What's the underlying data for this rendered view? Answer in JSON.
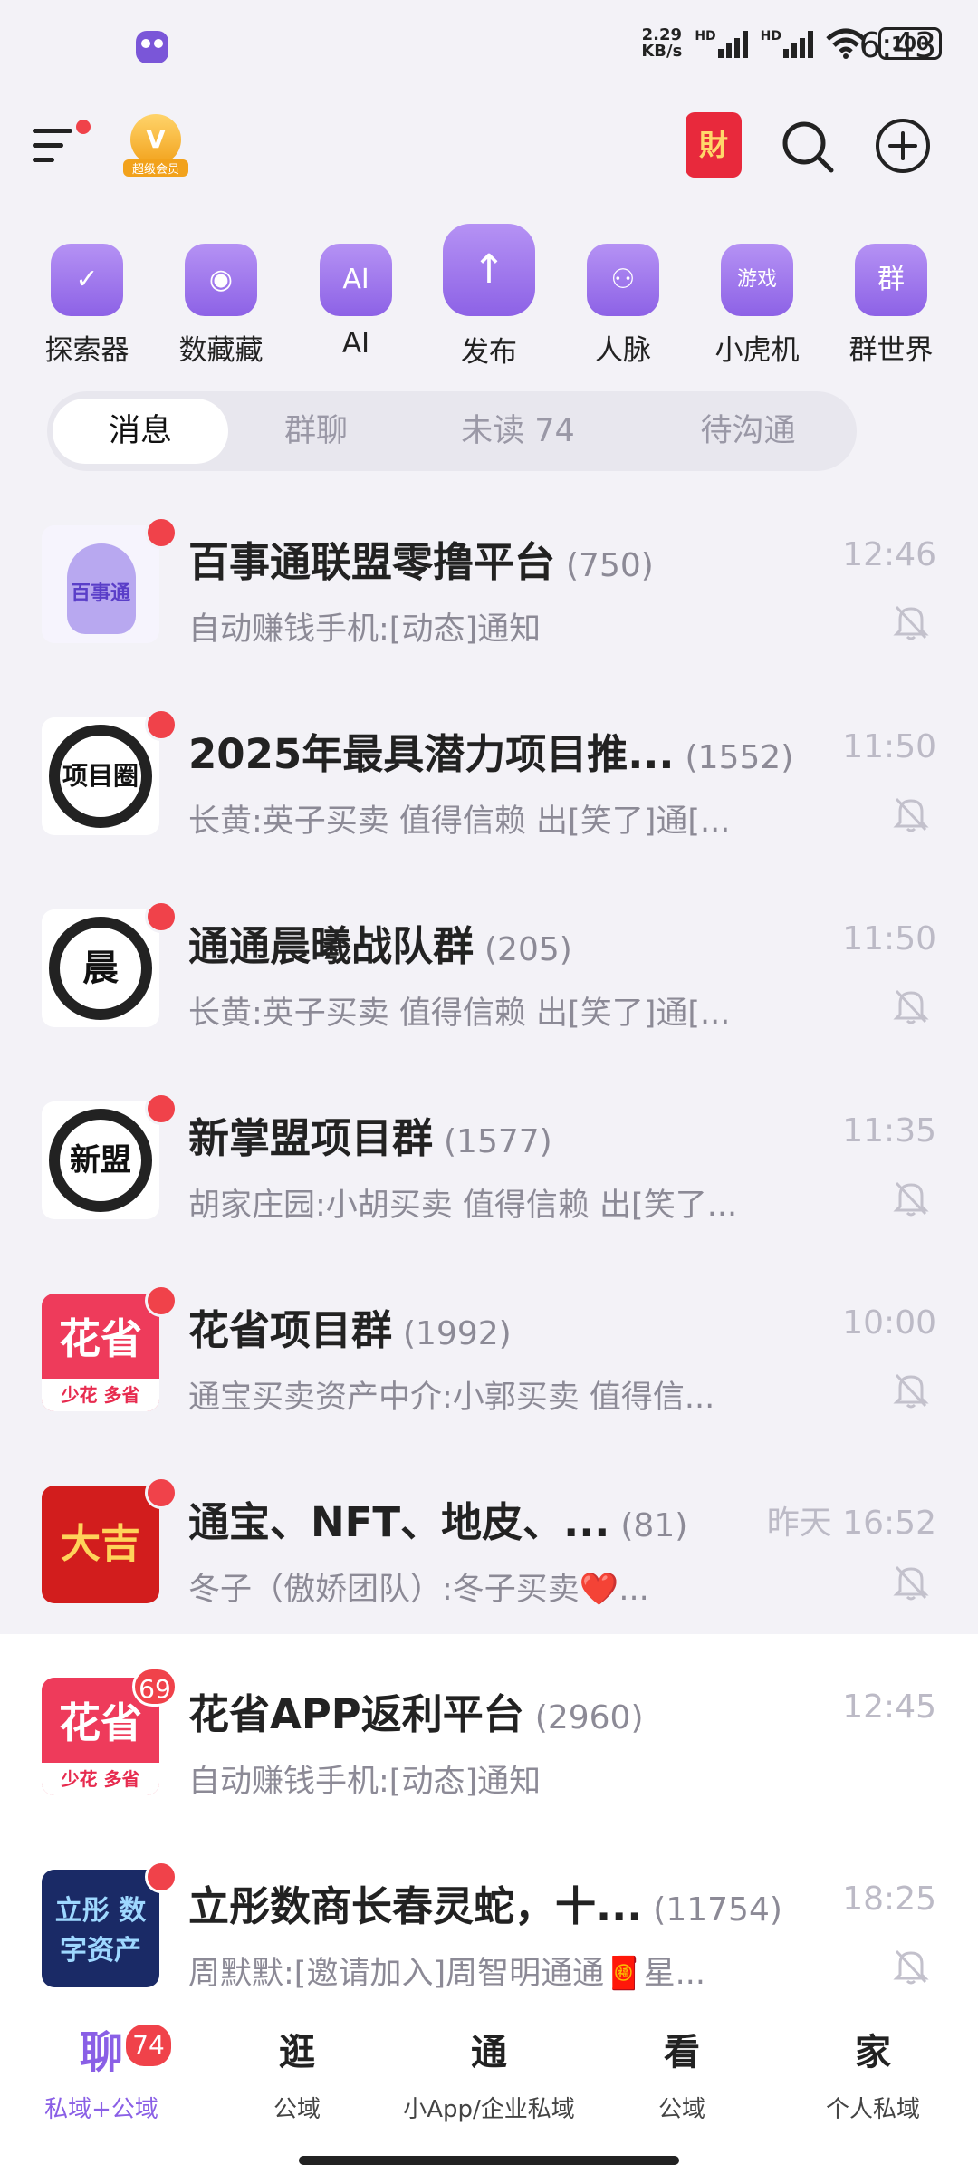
{
  "status_bar": {
    "time": "6:43",
    "netspeed_value": "2.29",
    "netspeed_unit": "KB/s",
    "hd1": "HD",
    "hd2": "HD",
    "battery": "100"
  },
  "header": {
    "vip_letter": "V",
    "vip_label": "超级会员",
    "redpacket_char": "財"
  },
  "shortcuts": [
    {
      "label": "探索器",
      "icon": "✓"
    },
    {
      "label": "数藏藏",
      "icon": "◉"
    },
    {
      "label": "AI",
      "icon": "AI"
    },
    {
      "label": "发布",
      "icon": "↑"
    },
    {
      "label": "人脉",
      "icon": "⚇"
    },
    {
      "label": "小虎机",
      "icon": "游戏"
    },
    {
      "label": "群世界",
      "icon": "群"
    }
  ],
  "tabs": [
    "消息",
    "群聊",
    "未读 74",
    "待沟通"
  ],
  "chats": [
    {
      "title": "百事通联盟零撸平台",
      "count": "(750)",
      "time": "12:46",
      "preview": "自动赚钱手机:[动态]通知",
      "avatar_text": "百事通"
    },
    {
      "title": "2025年最具潜力项目推...",
      "count": "(1552)",
      "time": "11:50",
      "preview": "长黄:英子买卖 值得信赖 出[笑了]通[...",
      "avatar_text": "项目圈"
    },
    {
      "title": "通通晨曦战队群",
      "count": "(205)",
      "time": "11:50",
      "preview": "长黄:英子买卖 值得信赖 出[笑了]通[...",
      "avatar_text": "晨"
    },
    {
      "title": "新掌盟项目群",
      "count": "(1577)",
      "time": "11:35",
      "preview": "胡家庄园:小胡买卖 值得信赖 出[笑了...",
      "avatar_text": "新盟"
    },
    {
      "title": "花省项目群",
      "count": "(1992)",
      "time": "10:00",
      "preview": "通宝买卖资产中介:小郭买卖 值得信...",
      "avatar_text": "花省",
      "avatar_sub": "少花 多省"
    },
    {
      "title": "通宝、NFT、地皮、...",
      "count": "(81)",
      "time": "昨天 16:52",
      "preview": "冬子（傲娇团队）:冬子买卖❤️...",
      "avatar_text": "大吉"
    },
    {
      "title": "花省APP返利平台",
      "count": "(2960)",
      "time": "12:45",
      "preview": "自动赚钱手机:[动态]通知",
      "avatar_text": "花省",
      "avatar_sub": "少花 多省",
      "badge": "69"
    },
    {
      "title": "立彤数商长春灵蛇，十...",
      "count": "(11754)",
      "time": "18:25",
      "preview": "周默默:[邀请加入]周智明通通🧧星...",
      "avatar_text": "立彤 数字资产"
    }
  ],
  "bottom_nav": [
    {
      "big": "聊",
      "small": "私域+公域",
      "badge": "74"
    },
    {
      "big": "逛",
      "small": "公域"
    },
    {
      "big": "通",
      "small": "小App/企业私域"
    },
    {
      "big": "看",
      "small": "公域"
    },
    {
      "big": "家",
      "small": "个人私域"
    }
  ]
}
